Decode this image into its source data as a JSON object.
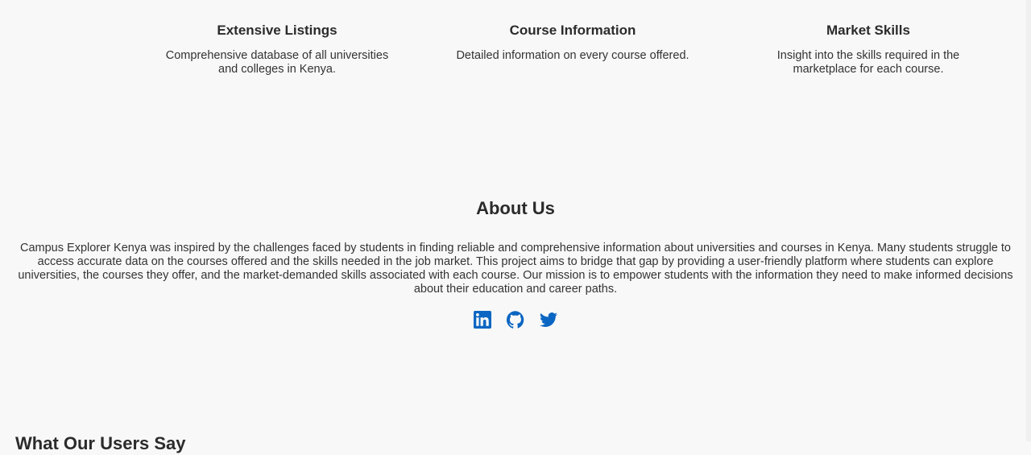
{
  "features": [
    {
      "title": "Extensive Listings",
      "description": "Comprehensive database of all universities and colleges in Kenya."
    },
    {
      "title": "Course Information",
      "description": "Detailed information on every course offered."
    },
    {
      "title": "Market Skills",
      "description": "Insight into the skills required in the marketplace for each course."
    }
  ],
  "about": {
    "title": "About Us",
    "text": "Campus Explorer Kenya was inspired by the challenges faced by students in finding reliable and comprehensive information about universities and courses in Kenya. Many students struggle to access accurate data on the courses offered and the skills needed in the job market. This project aims to bridge that gap by providing a user-friendly platform where students can explore universities, the courses they offer, and the market-demanded skills associated with each course. Our mission is to empower students with the information they need to make informed decisions about their education and career paths."
  },
  "social": {
    "icons": [
      "linkedin-icon",
      "github-icon",
      "twitter-icon"
    ],
    "color": "#0a66c2"
  },
  "next_section": {
    "title": "What Our Users Say"
  }
}
